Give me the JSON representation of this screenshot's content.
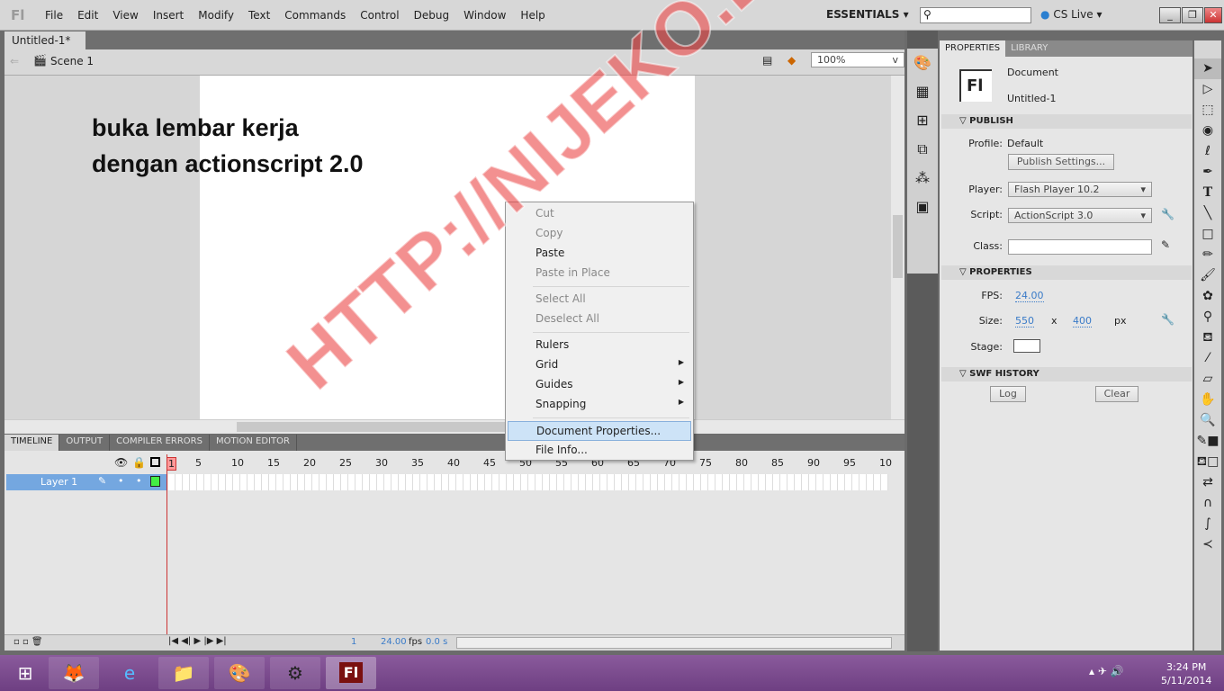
{
  "app": {
    "logo": "Fl",
    "menus": [
      "File",
      "Edit",
      "View",
      "Insert",
      "Modify",
      "Text",
      "Commands",
      "Control",
      "Debug",
      "Window",
      "Help"
    ],
    "workspace": "ESSENTIALS",
    "cs_live": "CS Live",
    "search_placeholder": ""
  },
  "document": {
    "tab": "Untitled-1*",
    "scene": "Scene 1",
    "zoom": "100%",
    "stage_text_line1": "buka lembar kerja",
    "stage_text_line2": "dengan actionscript 2.0"
  },
  "context_menu": {
    "items": [
      {
        "label": "Cut",
        "enabled": false
      },
      {
        "label": "Copy",
        "enabled": false
      },
      {
        "label": "Paste",
        "enabled": true
      },
      {
        "label": "Paste in Place",
        "enabled": false
      },
      {
        "label": "Select All",
        "enabled": false
      },
      {
        "label": "Deselect All",
        "enabled": false
      },
      {
        "label": "Rulers",
        "enabled": true
      },
      {
        "label": "Grid",
        "enabled": true,
        "submenu": true
      },
      {
        "label": "Guides",
        "enabled": true,
        "submenu": true
      },
      {
        "label": "Snapping",
        "enabled": true,
        "submenu": true
      },
      {
        "label": "Document Properties...",
        "enabled": true,
        "highlighted": true
      },
      {
        "label": "File Info...",
        "enabled": true
      }
    ]
  },
  "timeline": {
    "tabs": [
      "TIMELINE",
      "OUTPUT",
      "COMPILER ERRORS",
      "MOTION EDITOR"
    ],
    "frame_numbers": [
      "1",
      "5",
      "10",
      "15",
      "20",
      "25",
      "30",
      "35",
      "40",
      "45",
      "50",
      "55",
      "60",
      "65",
      "70",
      "75",
      "80",
      "85",
      "90",
      "95",
      "10"
    ],
    "layer": "Layer 1",
    "current_frame": "1",
    "fps": "24.00",
    "fps_unit": "fps",
    "time": "0.0 s"
  },
  "properties": {
    "tabs": [
      "PROPERTIES",
      "LIBRARY"
    ],
    "type": "Document",
    "name": "Untitled-1",
    "publish": {
      "title": "PUBLISH",
      "profile_label": "Profile:",
      "profile": "Default",
      "settings_button": "Publish Settings...",
      "player_label": "Player:",
      "player": "Flash Player 10.2",
      "script_label": "Script:",
      "script": "ActionScript 3.0",
      "class_label": "Class:"
    },
    "props": {
      "title": "PROPERTIES",
      "fps_label": "FPS:",
      "fps": "24.00",
      "size_label": "Size:",
      "width": "550",
      "x": "x",
      "height": "400",
      "unit": "px",
      "stage_label": "Stage:",
      "stage_color": "#ffffff"
    },
    "swf": {
      "title": "SWF HISTORY",
      "log": "Log",
      "clear": "Clear"
    }
  },
  "taskbar": {
    "time": "3:24 PM",
    "date": "5/11/2014"
  },
  "watermark": "HTTP://NIJEKO.BLOGSPOT.COM"
}
